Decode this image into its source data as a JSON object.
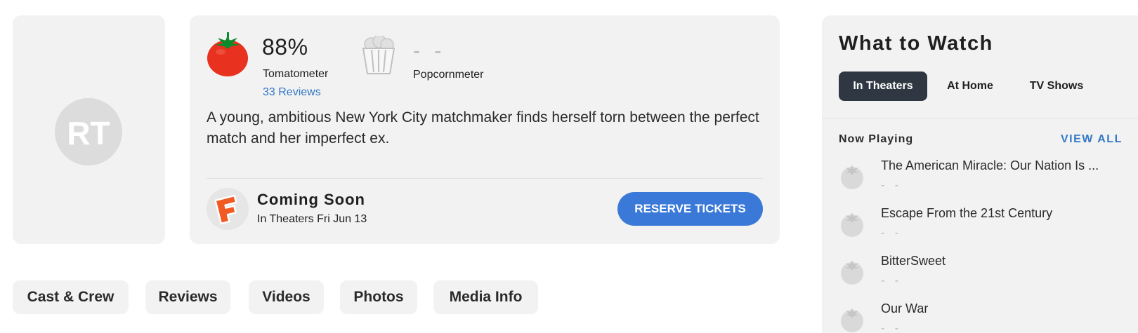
{
  "info": {
    "tomatometer_score": "88%",
    "tomatometer_label": "Tomatometer",
    "reviews_link": "33 Reviews",
    "popcornmeter_score": "- -",
    "popcornmeter_label": "Popcornmeter",
    "synopsis": "A young, ambitious New York City matchmaker finds herself torn between the perfect match and her imperfect ex.",
    "coming_soon": "Coming Soon",
    "release_date": "In Theaters Fri Jun 13",
    "reserve_button": "RESERVE TICKETS"
  },
  "icons": {
    "poster_placeholder": "rt-logo-icon",
    "tomatometer": "tomato-icon",
    "popcornmeter": "popcorn-bucket-icon",
    "ticketing": "fandango-icon",
    "movie_item": "tomato-placeholder-icon"
  },
  "colors": {
    "accent": "#3a79d8",
    "link": "#3478c6",
    "tomato": "#e8311e",
    "active_tab": "#2f3842",
    "card_bg": "#f2f2f2",
    "fandango_orange": "#f15a22"
  },
  "page_tabs": [
    {
      "label": "Cast & Crew"
    },
    {
      "label": "Reviews"
    },
    {
      "label": "Videos"
    },
    {
      "label": "Photos"
    },
    {
      "label": "Media Info"
    }
  ],
  "what_to_watch": {
    "title": "What to Watch",
    "tabs": [
      {
        "label": "In Theaters",
        "active": true
      },
      {
        "label": "At Home",
        "active": false
      },
      {
        "label": "TV Shows",
        "active": false
      }
    ],
    "section_label": "Now Playing",
    "view_all": "VIEW ALL",
    "movies": [
      {
        "title": "The American Miracle: Our Nation Is ...",
        "score": "- -"
      },
      {
        "title": "Escape From the 21st Century",
        "score": "- -"
      },
      {
        "title": "BitterSweet",
        "score": "- -"
      },
      {
        "title": "Our War",
        "score": "- -"
      }
    ]
  }
}
